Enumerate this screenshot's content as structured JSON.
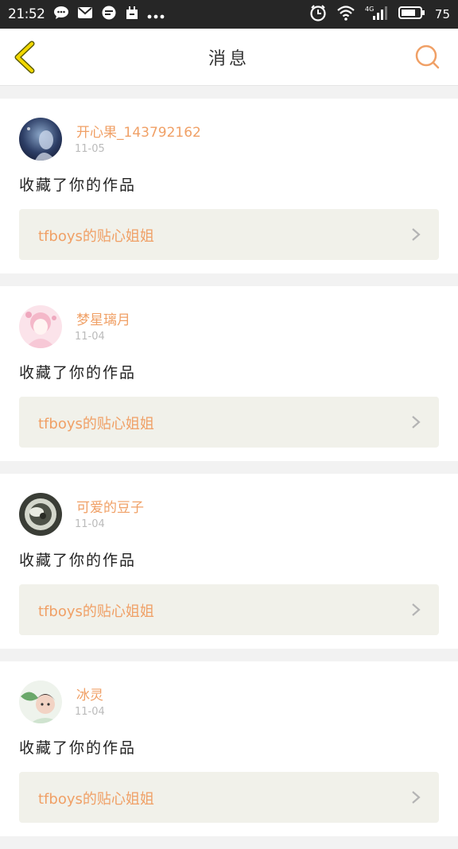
{
  "status_bar": {
    "time": "21:52",
    "battery": "75",
    "network": "4G"
  },
  "header": {
    "title": "消息"
  },
  "messages": [
    {
      "username": "开心果_143792162",
      "date": "11-05",
      "action": "收藏了你的作品",
      "work_title": "tfboys的贴心姐姐"
    },
    {
      "username": "梦星璃月",
      "date": "11-04",
      "action": "收藏了你的作品",
      "work_title": "tfboys的贴心姐姐"
    },
    {
      "username": "可爱的豆子",
      "date": "11-04",
      "action": "收藏了你的作品",
      "work_title": "tfboys的贴心姐姐"
    },
    {
      "username": "冰灵",
      "date": "11-04",
      "action": "收藏了你的作品",
      "work_title": "tfboys的贴心姐姐"
    }
  ],
  "colors": {
    "accent": "#f0a066",
    "back_arrow": "#e6c800",
    "status_bar": "#262626",
    "card_link_bg": "#f1f1ea"
  },
  "icons": {
    "back": "chevron-left-icon",
    "search": "search-icon",
    "row_arrow": "chevron-right-icon"
  }
}
